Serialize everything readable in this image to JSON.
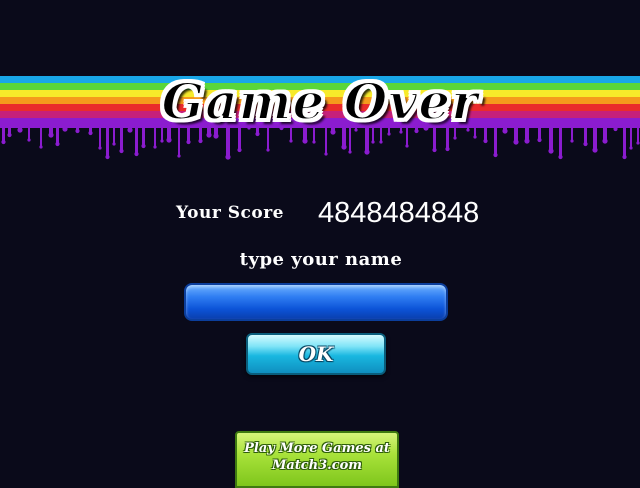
{
  "game_over": {
    "title": "Game Over",
    "score_label": "Your Score",
    "score_value": "4848484848",
    "name_prompt": "type  your name",
    "name_input_value": "",
    "ok_label": "OK",
    "more_games_line1": "Play More Games at",
    "more_games_line2": "Match3.com"
  },
  "colors": {
    "background": "#0a0a1a",
    "rainbow": [
      "#19a7e8",
      "#5ad63a",
      "#f7ea2a",
      "#f59a1c",
      "#ea2b2b",
      "#c6207a",
      "#8b1ccf"
    ],
    "drip": "#8b1ccf",
    "input_fill": "#0c54d8",
    "ok_fill": "#19b7e0",
    "more_games_fill": "#a8e23a"
  }
}
